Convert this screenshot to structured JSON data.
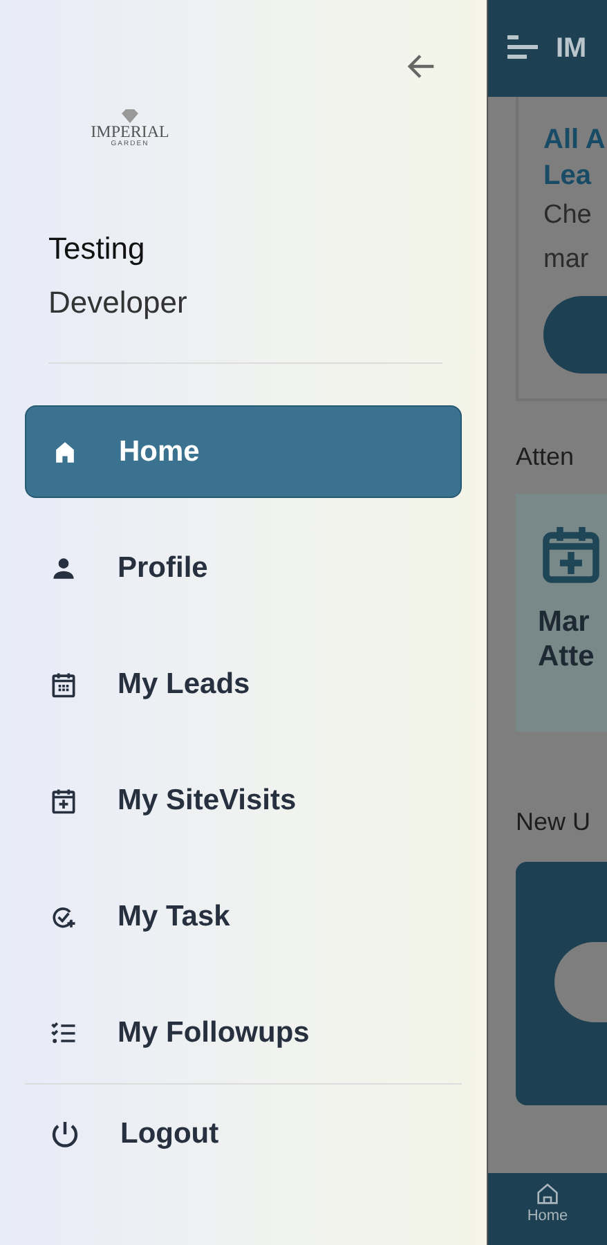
{
  "drawer": {
    "logo": {
      "name": "IMPERIAL",
      "tagline": "GARDEN"
    },
    "user": {
      "name": "Testing",
      "role": "Developer"
    },
    "items": [
      {
        "label": "Home",
        "kind": "home",
        "selected": true
      },
      {
        "label": "Profile",
        "kind": "person",
        "selected": false
      },
      {
        "label": "My Leads",
        "kind": "calendar",
        "selected": false
      },
      {
        "label": "My SiteVisits",
        "kind": "calendar-plus",
        "selected": false
      },
      {
        "label": "My Task",
        "kind": "task",
        "selected": false
      },
      {
        "label": "My Followups",
        "kind": "checklist",
        "selected": false
      }
    ],
    "logout": {
      "label": "Logout"
    }
  },
  "background_app": {
    "header_title": "IM",
    "card": {
      "title_lines": [
        "All A",
        "Lea"
      ],
      "text_lines": [
        "Che",
        "mar"
      ]
    },
    "attendance": {
      "heading": "Atten",
      "card_lines": [
        "Mar",
        "Atte"
      ]
    },
    "new_section": {
      "heading": "New U"
    },
    "bottom_nav": {
      "label": "Home"
    }
  }
}
